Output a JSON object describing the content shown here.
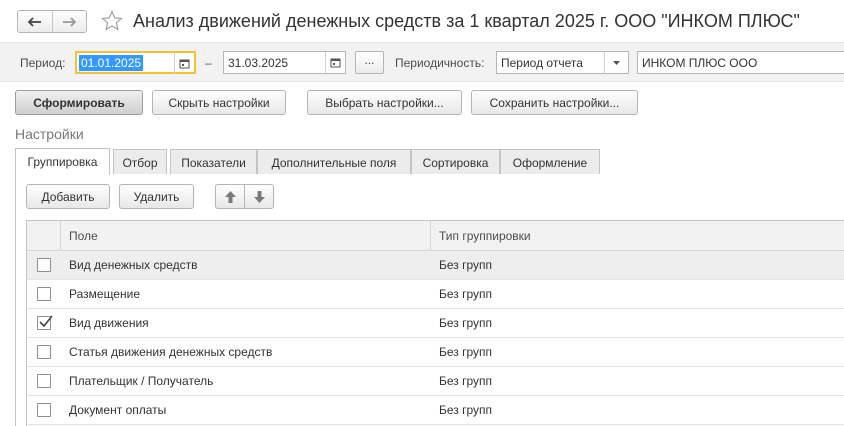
{
  "window": {
    "title": "Анализ движений денежных средств за 1 квартал 2025 г. ООО \"ИНКОМ ПЛЮС\""
  },
  "params": {
    "period_label": "Период:",
    "date_from": "01.01.2025",
    "date_dash": "–",
    "date_to": "31.03.2025",
    "period_button": "...",
    "periodicity_label": "Периодичность:",
    "periodicity_value": "Период отчета",
    "organization": "ИНКОМ ПЛЮС ООО"
  },
  "actions": {
    "generate": "Сформировать",
    "hide_settings": "Скрыть настройки",
    "choose_settings": "Выбрать настройки...",
    "save_settings": "Сохранить настройки..."
  },
  "settings": {
    "title": "Настройки",
    "tabs": [
      {
        "label": "Группировка",
        "active": true
      },
      {
        "label": "Отбор"
      },
      {
        "label": "Показатели"
      },
      {
        "label": "Дополнительные поля"
      },
      {
        "label": "Сортировка"
      },
      {
        "label": "Оформление"
      }
    ],
    "add": "Добавить",
    "delete": "Удалить",
    "columns": {
      "field": "Поле",
      "group_type": "Тип группировки"
    },
    "rows": [
      {
        "field": "Вид денежных средств",
        "group_type": "Без групп",
        "checked": false
      },
      {
        "field": "Размещение",
        "group_type": "Без групп",
        "checked": false
      },
      {
        "field": "Вид движения",
        "group_type": "Без групп",
        "checked": true
      },
      {
        "field": "Статья движения денежных средств",
        "group_type": "Без групп",
        "checked": false
      },
      {
        "field": "Плательщик / Получатель",
        "group_type": "Без групп",
        "checked": false
      },
      {
        "field": "Документ оплаты",
        "group_type": "Без групп",
        "checked": false
      }
    ]
  },
  "icons": {
    "back": "arrow-left-icon",
    "forward": "arrow-right-icon",
    "favorite": "star-icon",
    "calendar": "calendar-icon",
    "dropdown": "chevron-down-icon",
    "up": "arrow-up-icon",
    "down": "arrow-down-icon",
    "check": "check-icon"
  }
}
